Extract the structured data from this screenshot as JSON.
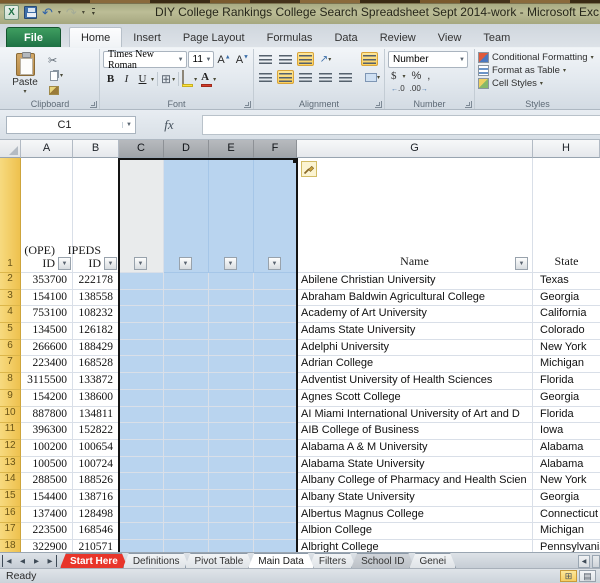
{
  "theme": {
    "selection-fill": "#b9d4ef",
    "active-cell-fill": "#e9ebec",
    "start-here-red": "#e8352a",
    "file-tab-green": "#1e7145",
    "row-header-highlight": "#eec14e",
    "ribbon-highlight": "#fbd05e"
  },
  "window": {
    "title": "DIY College Rankings College Search Spreadsheet Sept 2014-work - Microsoft Exc",
    "qat": {
      "excel_icon": "X",
      "undo_glyph": "↶",
      "redo_glyph": "↷"
    }
  },
  "ribbon_tabs": [
    {
      "label": "File",
      "type": "file"
    },
    {
      "label": "Home",
      "active": true
    },
    {
      "label": "Insert"
    },
    {
      "label": "Page Layout"
    },
    {
      "label": "Formulas"
    },
    {
      "label": "Data"
    },
    {
      "label": "Review"
    },
    {
      "label": "View"
    },
    {
      "label": "Team"
    }
  ],
  "ribbon": {
    "clipboard": {
      "group_label": "Clipboard",
      "paste_label": "Paste"
    },
    "font": {
      "group_label": "Font",
      "font_name": "Times New Roman",
      "font_size": "11",
      "bold": "B",
      "italic": "I",
      "underline": "U",
      "grow": "A",
      "shrink": "A"
    },
    "alignment": {
      "group_label": "Alignment"
    },
    "number": {
      "group_label": "Number",
      "format_value": "Number",
      "currency": "$",
      "percent": "%",
      "comma": ",",
      "inc_decimal": ".0",
      "dec_decimal": ".00"
    },
    "styles": {
      "group_label": "Styles",
      "items": [
        "Conditional Formatting",
        "Format as Table",
        "Cell Styles"
      ]
    }
  },
  "formula_bar": {
    "name_box": "C1",
    "fx_label": "fx",
    "content": ""
  },
  "grid": {
    "column_headers": [
      {
        "label": "A"
      },
      {
        "label": "B"
      },
      {
        "label": "C",
        "selected": true
      },
      {
        "label": "D",
        "selected": true
      },
      {
        "label": "E",
        "selected": true
      },
      {
        "label": "F",
        "selected": true
      },
      {
        "label": "G"
      },
      {
        "label": "H"
      }
    ],
    "header_row": {
      "number": "1",
      "ope_line1": "(OPE)",
      "ope_line2": "ID",
      "ipeds_line1": "IPEDS",
      "ipeds_line2": "ID",
      "name_label": "Name",
      "state_label": "State"
    },
    "rows": [
      {
        "n": "2",
        "ope": "353700",
        "ipeds": "222178",
        "name": "Abilene Christian University",
        "state": "Texas"
      },
      {
        "n": "3",
        "ope": "154100",
        "ipeds": "138558",
        "name": "Abraham Baldwin Agricultural College",
        "state": "Georgia"
      },
      {
        "n": "4",
        "ope": "753100",
        "ipeds": "108232",
        "name": "Academy of Art University",
        "state": "California"
      },
      {
        "n": "5",
        "ope": "134500",
        "ipeds": "126182",
        "name": "Adams State University",
        "state": "Colorado"
      },
      {
        "n": "6",
        "ope": "266600",
        "ipeds": "188429",
        "name": "Adelphi University",
        "state": "New York"
      },
      {
        "n": "7",
        "ope": "223400",
        "ipeds": "168528",
        "name": "Adrian College",
        "state": "Michigan"
      },
      {
        "n": "8",
        "ope": "3115500",
        "ipeds": "133872",
        "name": "Adventist University of Health Sciences",
        "state": "Florida"
      },
      {
        "n": "9",
        "ope": "154200",
        "ipeds": "138600",
        "name": "Agnes Scott College",
        "state": "Georgia"
      },
      {
        "n": "10",
        "ope": "887800",
        "ipeds": "134811",
        "name": "AI Miami International University of Art and D",
        "state": "Florida"
      },
      {
        "n": "11",
        "ope": "396300",
        "ipeds": "152822",
        "name": "AIB College of Business",
        "state": "Iowa"
      },
      {
        "n": "12",
        "ope": "100200",
        "ipeds": "100654",
        "name": "Alabama A & M University",
        "state": "Alabama"
      },
      {
        "n": "13",
        "ope": "100500",
        "ipeds": "100724",
        "name": "Alabama State University",
        "state": "Alabama"
      },
      {
        "n": "14",
        "ope": "288500",
        "ipeds": "188526",
        "name": "Albany College of Pharmacy and Health Scien",
        "state": "New York"
      },
      {
        "n": "15",
        "ope": "154400",
        "ipeds": "138716",
        "name": "Albany State University",
        "state": "Georgia"
      },
      {
        "n": "16",
        "ope": "137400",
        "ipeds": "128498",
        "name": "Albertus Magnus College",
        "state": "Connecticut"
      },
      {
        "n": "17",
        "ope": "223500",
        "ipeds": "168546",
        "name": "Albion College",
        "state": "Michigan"
      },
      {
        "n": "18",
        "ope": "322900",
        "ipeds": "210571",
        "name": "Albright College",
        "state": "Pennsylvania"
      }
    ]
  },
  "sheet_tabs": {
    "nav_glyphs": {
      "first": "◀",
      "prev": "◀",
      "next": "▶",
      "last": "▶"
    },
    "tabs": [
      {
        "label": "Start Here",
        "color": "red"
      },
      {
        "label": "Definitions"
      },
      {
        "label": "Pivot Table"
      },
      {
        "label": "Main Data",
        "active": true
      },
      {
        "label": "Filters"
      },
      {
        "label": "School ID",
        "color": "gray"
      },
      {
        "label": "Genei"
      }
    ],
    "scroll_left_glyph": "◀"
  },
  "status_bar": {
    "mode": "Ready"
  }
}
